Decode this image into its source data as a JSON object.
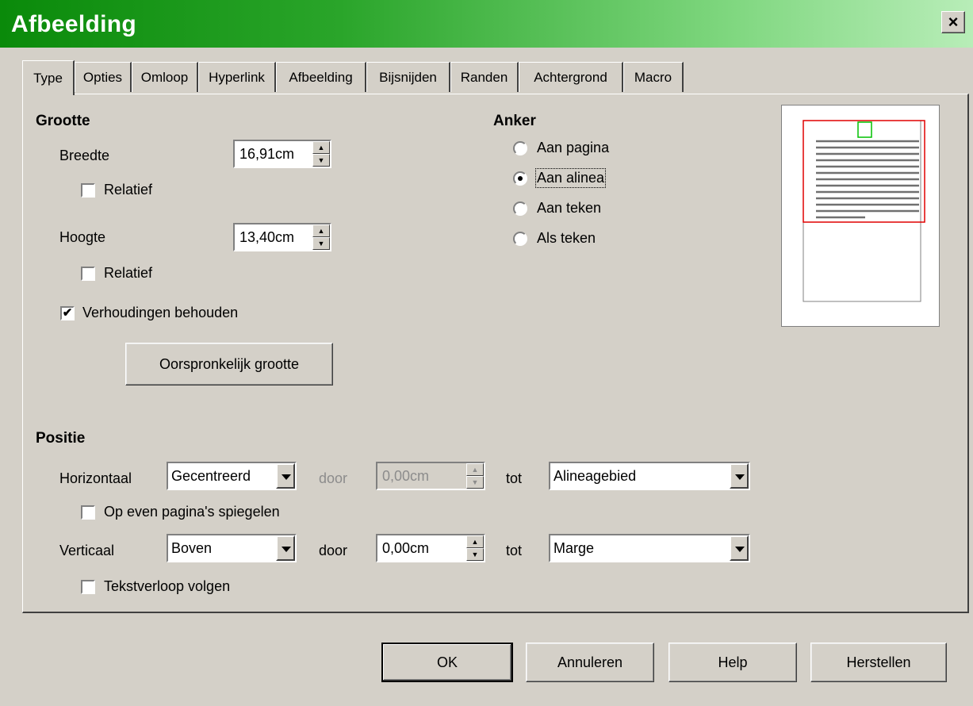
{
  "window": {
    "title": "Afbeelding",
    "close_symbol": "×"
  },
  "tabs": [
    "Type",
    "Opties",
    "Omloop",
    "Hyperlink",
    "Afbeelding",
    "Bijsnijden",
    "Randen",
    "Achtergrond",
    "Macro"
  ],
  "active_tab": "Type",
  "size": {
    "heading": "Grootte",
    "width_label": "Breedte",
    "width_value": "16,91cm",
    "width_relative_label": "Relatief",
    "width_relative_checked": false,
    "height_label": "Hoogte",
    "height_value": "13,40cm",
    "height_relative_label": "Relatief",
    "height_relative_checked": false,
    "keep_ratio_label": "Verhoudingen behouden",
    "keep_ratio_checked": true,
    "original_size_button": "Oorspronkelijk grootte"
  },
  "anchor": {
    "heading": "Anker",
    "options": [
      "Aan pagina",
      "Aan alinea",
      "Aan teken",
      "Als teken"
    ],
    "selected": "Aan alinea"
  },
  "position": {
    "heading": "Positie",
    "horizontal_label": "Horizontaal",
    "horizontal_value": "Gecentreerd",
    "horizontal_by_label": "door",
    "horizontal_by_value": "0,00cm",
    "horizontal_to_label": "tot",
    "horizontal_to_value": "Alineagebied",
    "mirror_label": "Op even pagina's spiegelen",
    "mirror_checked": false,
    "vertical_label": "Verticaal",
    "vertical_value": "Boven",
    "vertical_by_label": "door",
    "vertical_by_value": "0,00cm",
    "vertical_to_label": "tot",
    "vertical_to_value": "Marge",
    "follow_text_label": "Tekstverloop volgen",
    "follow_text_checked": false
  },
  "buttons": {
    "ok": "OK",
    "cancel": "Annuleren",
    "help": "Help",
    "reset": "Herstellen"
  },
  "colors": {
    "title_gradient_start": "#0a8a0a",
    "title_gradient_end": "#b8edb8",
    "dialog_bg": "#d4d0c8",
    "preview_frame": "#e00000",
    "preview_anchor": "#00c000",
    "preview_lines": "#707070"
  }
}
